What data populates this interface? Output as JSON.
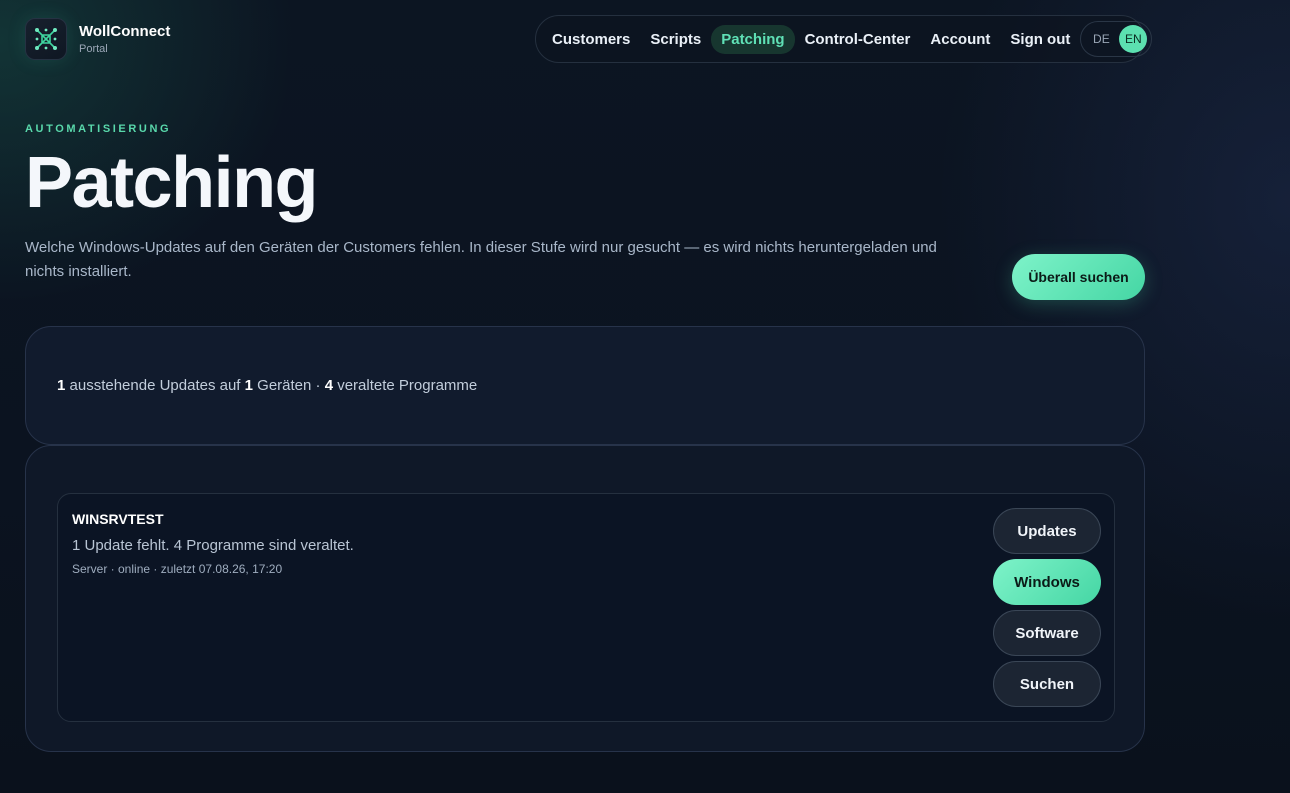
{
  "brand": {
    "name": "WollConnect",
    "subtitle": "Portal"
  },
  "nav": {
    "items": [
      {
        "label": "Customers"
      },
      {
        "label": "Scripts"
      },
      {
        "label": "Patching",
        "active": true
      },
      {
        "label": "Control-Center"
      },
      {
        "label": "Account"
      },
      {
        "label": "Sign out"
      }
    ],
    "languages": [
      {
        "code": "DE"
      },
      {
        "code": "EN",
        "active": true
      }
    ]
  },
  "hero": {
    "eyebrow": "AUTOMATISIERUNG",
    "title": "Patching",
    "description": "Welche Windows-Updates auf den Geräten der Customers fehlen. In dieser Stufe wird nur gesucht — es wird nichts heruntergeladen und nichts installiert.",
    "overall_button": "Überall suchen"
  },
  "summary": {
    "pending_updates": "1",
    "updates_text": " ausstehende Updates auf ",
    "devices": "1",
    "devices_text": " Geräten · ",
    "outdated_programs": "4",
    "programs_text": " veraltete Programme"
  },
  "devices": [
    {
      "name": "WINSRVTEST",
      "status": "1 Update fehlt. 4 Programme sind veraltet.",
      "meta": "Server · online · zuletzt 07.08.26, 17:20",
      "actions": {
        "updates": "Updates",
        "windows": "Windows",
        "software": "Software",
        "search": "Suchen"
      }
    }
  ],
  "colors": {
    "accent": "#5ce0b0",
    "background": "#0b1320",
    "card": "#111b2d"
  },
  "icons": {
    "logo": "grid-network-icon"
  }
}
